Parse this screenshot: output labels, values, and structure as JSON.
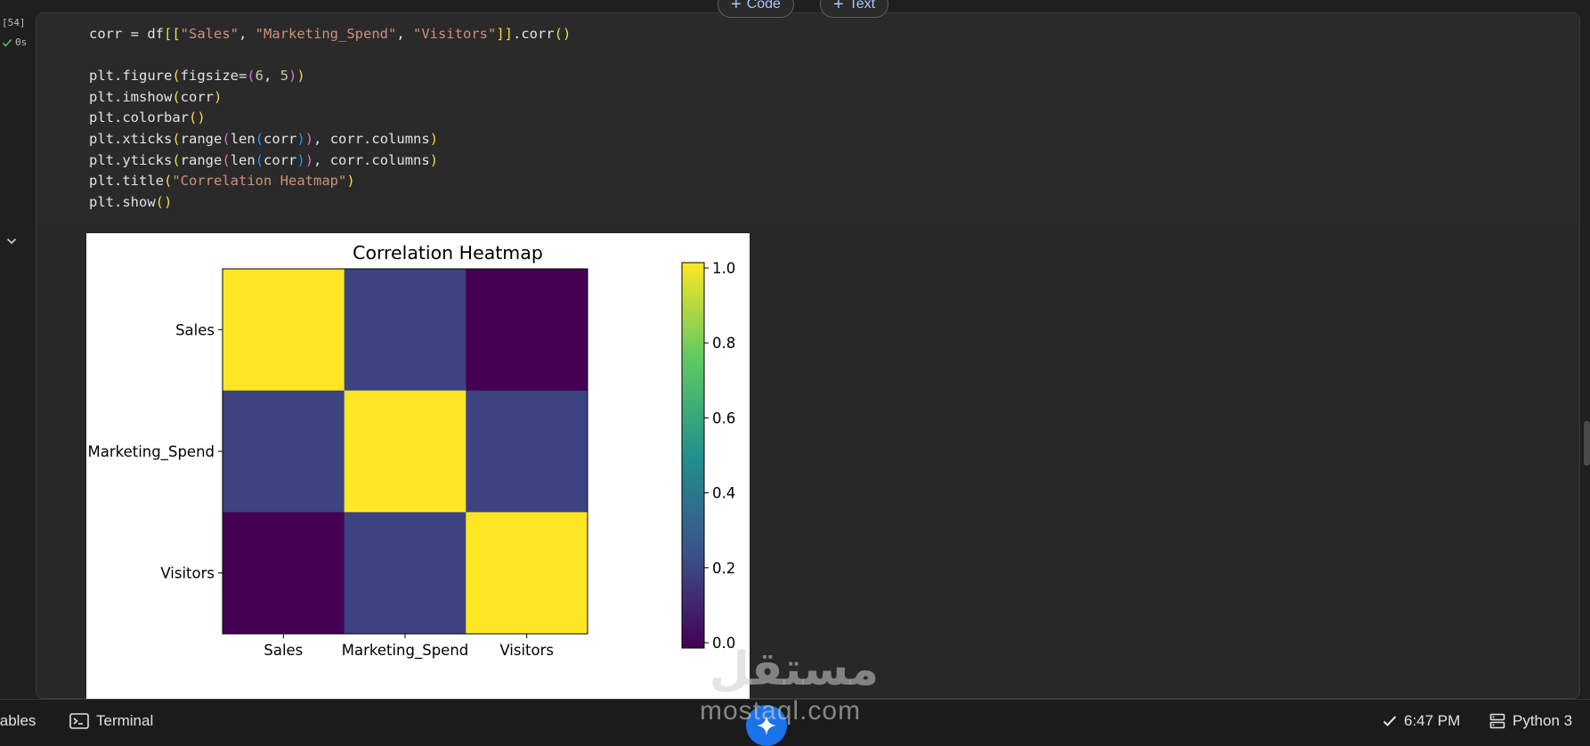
{
  "cell": {
    "execution_count": "[54]",
    "execution_time": "0s",
    "code_lines": [
      [
        {
          "t": "corr = df"
        },
        {
          "t": "[[",
          "c": "#f9d849"
        },
        {
          "t": "\"Sales\"",
          "c": "#ce9178"
        },
        {
          "t": ", "
        },
        {
          "t": "\"Marketing_Spend\"",
          "c": "#ce9178"
        },
        {
          "t": ", "
        },
        {
          "t": "\"Visitors\"",
          "c": "#ce9178"
        },
        {
          "t": "]]",
          "c": "#f9d849"
        },
        {
          "t": ".corr"
        },
        {
          "t": "()",
          "c": "#f9d849"
        }
      ],
      [
        {
          "t": ""
        }
      ],
      [
        {
          "t": "plt.figure"
        },
        {
          "t": "(",
          "c": "#f9d849"
        },
        {
          "t": "figsize="
        },
        {
          "t": "(",
          "c": "#da70d6"
        },
        {
          "t": "6",
          "c": "#b5cea8"
        },
        {
          "t": ", "
        },
        {
          "t": "5",
          "c": "#b5cea8"
        },
        {
          "t": ")",
          "c": "#da70d6"
        },
        {
          "t": ")",
          "c": "#f9d849"
        }
      ],
      [
        {
          "t": "plt.imshow"
        },
        {
          "t": "(",
          "c": "#f9d849"
        },
        {
          "t": "corr"
        },
        {
          "t": ")",
          "c": "#f9d849"
        }
      ],
      [
        {
          "t": "plt.colorbar"
        },
        {
          "t": "()",
          "c": "#f9d849"
        }
      ],
      [
        {
          "t": "plt.xticks"
        },
        {
          "t": "(",
          "c": "#f9d849"
        },
        {
          "t": "range"
        },
        {
          "t": "(",
          "c": "#da70d6"
        },
        {
          "t": "len"
        },
        {
          "t": "(",
          "c": "#179fff"
        },
        {
          "t": "corr"
        },
        {
          "t": ")",
          "c": "#179fff"
        },
        {
          "t": ")",
          "c": "#da70d6"
        },
        {
          "t": ", corr.columns"
        },
        {
          "t": ")",
          "c": "#f9d849"
        }
      ],
      [
        {
          "t": "plt.yticks"
        },
        {
          "t": "(",
          "c": "#f9d849"
        },
        {
          "t": "range"
        },
        {
          "t": "(",
          "c": "#da70d6"
        },
        {
          "t": "len"
        },
        {
          "t": "(",
          "c": "#179fff"
        },
        {
          "t": "corr"
        },
        {
          "t": ")",
          "c": "#179fff"
        },
        {
          "t": ")",
          "c": "#da70d6"
        },
        {
          "t": ", corr.columns"
        },
        {
          "t": ")",
          "c": "#f9d849"
        }
      ],
      [
        {
          "t": "plt.title"
        },
        {
          "t": "(",
          "c": "#f9d849"
        },
        {
          "t": "\"Correlation Heatmap\"",
          "c": "#ce9178"
        },
        {
          "t": ")",
          "c": "#f9d849"
        }
      ],
      [
        {
          "t": "plt.show"
        },
        {
          "t": "()",
          "c": "#f9d849"
        }
      ]
    ]
  },
  "toolbar": {
    "add_code_label": "Code",
    "add_text_label": "Text"
  },
  "chart_data": {
    "type": "heatmap",
    "title": "Correlation Heatmap",
    "x_labels": [
      "Sales",
      "Marketing_Spend",
      "Visitors"
    ],
    "y_labels": [
      "Sales",
      "Marketing_Spend",
      "Visitors"
    ],
    "values": [
      [
        1.0,
        0.2,
        0.0
      ],
      [
        0.2,
        1.0,
        0.2
      ],
      [
        0.0,
        0.2,
        1.0
      ]
    ],
    "colormap": "viridis",
    "colorbar_range": [
      0.0,
      1.0
    ],
    "colorbar_ticks": [
      "0.0",
      "0.2",
      "0.4",
      "0.6",
      "0.8",
      "1.0"
    ]
  },
  "bottom_bar": {
    "variables_label": "iables",
    "terminal_label": "Terminal",
    "time": "6:47 PM",
    "runtime": "Python 3"
  },
  "watermark": {
    "word": "مستقل",
    "url": "mostaql.com"
  },
  "colors": {
    "background": "#1f1f1f",
    "cell_background": "#2a2a2a",
    "accent_blue": "#a8c7fa",
    "success_green": "#5bb974",
    "string_color": "#ce9178",
    "number_color": "#b5cea8",
    "bracket_yellow": "#f9d849",
    "bracket_purple": "#da70d6",
    "bracket_blue": "#179fff"
  }
}
